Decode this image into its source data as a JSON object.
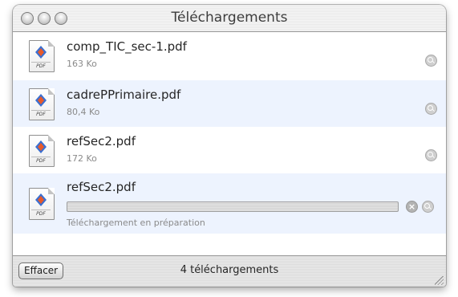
{
  "window": {
    "title": "Téléchargements"
  },
  "downloads": [
    {
      "name": "comp_TIC_sec-1.pdf",
      "size": "163 Ko",
      "icon": "pdf-document-icon",
      "file_tag": "PDF"
    },
    {
      "name": "cadrePPrimaire.pdf",
      "size": "80,4 Ko",
      "icon": "pdf-document-icon",
      "file_tag": "PDF"
    },
    {
      "name": "refSec2.pdf",
      "size": "172 Ko",
      "icon": "pdf-document-icon",
      "file_tag": "PDF"
    },
    {
      "name": "refSec2.pdf",
      "status": "Téléchargement en préparation",
      "progress": 0,
      "icon": "pdf-document-icon",
      "file_tag": "PDF"
    }
  ],
  "footer": {
    "clear_label": "Effacer",
    "count_label": "4 téléchargements"
  },
  "colors": {
    "alt_row": "#edf3fe",
    "window_chrome": "#e9e9e9"
  }
}
